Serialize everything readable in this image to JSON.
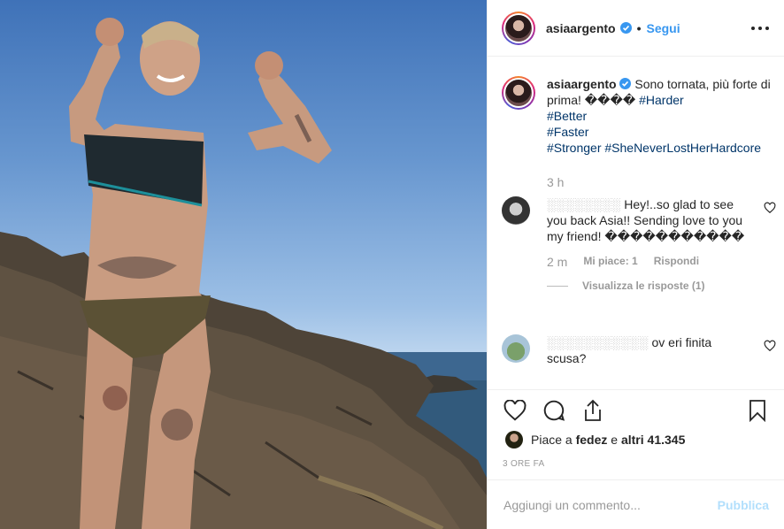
{
  "post": {
    "username": "asiaargento",
    "follow_label": "Segui",
    "dot": "•"
  },
  "caption": {
    "username": "asiaargento",
    "text": "Sono tornata, più forte di prima! ����",
    "hashtags": [
      "#Harder",
      "#Better",
      "#Faster",
      "#Stronger",
      "#SheNeverLostHerHardcore"
    ],
    "time": "3 h"
  },
  "comments": [
    {
      "username_obscured": "░░░░░░░░",
      "text": "Hey!..so glad to see you back Asia!! Sending love to you my friend! �����������",
      "time": "2 m",
      "likes_label": "Mi piace: 1",
      "reply_label": "Rispondi",
      "view_replies": "Visualizza le risposte (1)"
    },
    {
      "username_obscured": "░░░░░░░░░░░",
      "text": "ov eri finita scusa?"
    }
  ],
  "likes": {
    "prefix": "Piace a",
    "user": "fedez",
    "joiner": "e",
    "others": "altri 41.345"
  },
  "ago": "3 ORE FA",
  "add_comment": {
    "placeholder": "Aggiungi un commento...",
    "publish_label": "Pubblica"
  },
  "colors": {
    "link": "#3897f0",
    "hashtag": "#003569",
    "muted": "#999999"
  }
}
